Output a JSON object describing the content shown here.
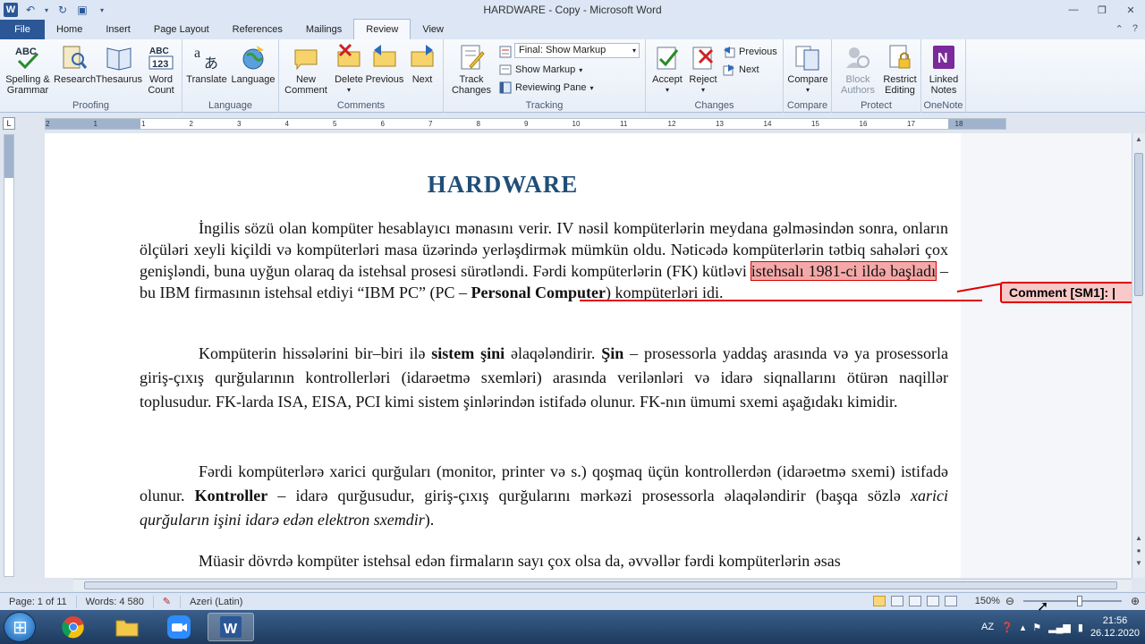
{
  "window": {
    "title": "HARDWARE - Copy - Microsoft Word",
    "min": "—",
    "max": "❐",
    "close": "✕"
  },
  "tabs": [
    {
      "label": "File"
    },
    {
      "label": "Home"
    },
    {
      "label": "Insert"
    },
    {
      "label": "Page Layout"
    },
    {
      "label": "References"
    },
    {
      "label": "Mailings"
    },
    {
      "label": "Review"
    },
    {
      "label": "View"
    }
  ],
  "tabs_right": {
    "help": "?",
    "min_ribbon": "⌃"
  },
  "ribbon": {
    "groups": {
      "proofing": "Proofing",
      "language": "Language",
      "comments": "Comments",
      "tracking": "Tracking",
      "changes": "Changes",
      "compare": "Compare",
      "protect": "Protect",
      "onenote": "OneNote"
    },
    "buttons": {
      "spelling": "Spelling &",
      "spelling2": "Grammar",
      "research": "Research",
      "thesaurus": "Thesaurus",
      "wordcount": "Word",
      "wordcount2": "Count",
      "translate": "Translate",
      "language": "Language",
      "new_comment": "New",
      "new_comment2": "Comment",
      "delete": "Delete",
      "previous": "Previous",
      "next": "Next",
      "track_changes": "Track",
      "track_changes2": "Changes",
      "final_markup": "Final: Show Markup",
      "show_markup": "Show Markup",
      "reviewing_pane": "Reviewing Pane",
      "accept": "Accept",
      "reject": "Reject",
      "prev_change": "Previous",
      "next_change": "Next",
      "compare": "Compare",
      "block": "Block",
      "block2": "Authors",
      "restrict": "Restrict",
      "restrict2": "Editing",
      "linked": "Linked",
      "linked2": "Notes"
    }
  },
  "ruler": {
    "ticks": [
      "2",
      "1",
      "1",
      "2",
      "3",
      "4",
      "5",
      "6",
      "7",
      "8",
      "9",
      "10",
      "11",
      "12",
      "13",
      "14",
      "15",
      "16",
      "17",
      "18"
    ]
  },
  "document": {
    "title": "HARDWARE",
    "p1": {
      "a": "İngilis sözü olan kompüter hesablayıcı mənasını verir. IV nəsil kompüterlərin meydana gəlməsindən sonra, onların ölçüləri xeyli kiçildi və kompüterləri masa üzərində yerləşdirmək mümkün oldu. Nəticədə kompüterlərin tətbiq sahələri çox genişləndi, buna uyğun olaraq da istehsal prosesi sürətləndi. Fərdi kompüterlərin (FK) kütləvi ",
      "highlight": "istehsalı 1981-ci ildə başladı",
      "b": " – bu IBM firmasının istehsal etdiyi “IBM PC” (PC – ",
      "bold": "Personal Computer",
      "c": ") kompüterləri idi."
    },
    "p2": {
      "a": "Kompüterin hissələrini bir–biri ilə ",
      "bold1": "sistem şini",
      "b": " əlaqələndirir. ",
      "bold2": "Şin",
      "c": " – prosessorla yaddaş arasında və ya prosessorla giriş-çıxış qurğularının kontrollerləri (idarəetmə sxemləri) arasında verilənləri və idarə siqnallarını ötürən naqillər toplusudur. FK-larda ISA, EISA, PCI kimi sistem şinlərindən istifadə olunur. FK-nın ümumi sxemi aşağıdakı kimidir."
    },
    "p3": {
      "a": "Fərdi kompüterlərə xarici qurğuları (monitor, printer və s.) qoşmaq üçün kontrollerdən (idarəetmə sxemi) istifadə olunur. ",
      "bold": "Kontroller",
      "b": " – idarə qurğusudur, giriş-çıxış qurğularını mərkəzi prosessorla əlaqələndirir (başqa sözlə ",
      "italic": "xarici qurğuların işini idarə edən elektron sxemdir",
      "c": ")."
    },
    "p4": {
      "a": "Müasir dövrdə kompüter istehsal edən firmaların sayı çox olsa da, əvvəllər fərdi kompüterlərin əsas"
    },
    "comment": "Comment [SM1]: "
  },
  "status": {
    "page": "Page: 1 of 11",
    "words": "Words: 4 580",
    "language": "Azeri (Latin)",
    "zoom": "150%"
  },
  "taskbar": {
    "lang": "AZ",
    "time": "21:56",
    "date": "26.12.2020"
  },
  "colors": {
    "word_blue": "#2b5797",
    "title_blue": "#1f4e79",
    "comment_red": "#e00000",
    "comment_fill": "#fbc8c8"
  }
}
